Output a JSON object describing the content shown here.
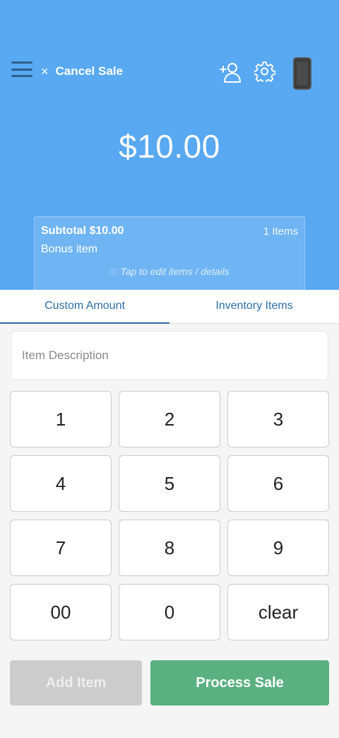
{
  "colors": {
    "header": "#58a8f2",
    "accent": "#2f6fa6",
    "process": "#5bb082",
    "disabled": "#cccccc"
  },
  "header": {
    "cancel_label": "Cancel Sale",
    "close_glyph": "×",
    "icons": [
      "menu-icon",
      "add-customer-icon",
      "gear-icon",
      "card-reader-device-icon"
    ],
    "amount": "$10.00"
  },
  "summary": {
    "subtotal": "Subtotal $10.00",
    "count": "1 Items",
    "item": "Bonus item",
    "info_glyph": "ⓘ",
    "hint": "Tap to edit items / details"
  },
  "tabs": [
    {
      "label": "Custom Amount",
      "active": true
    },
    {
      "label": "Inventory Items",
      "active": false
    }
  ],
  "description": {
    "placeholder": "Item Description",
    "value": ""
  },
  "keypad": [
    "1",
    "2",
    "3",
    "4",
    "5",
    "6",
    "7",
    "8",
    "9",
    "00",
    "0",
    "clear"
  ],
  "actions": {
    "add_item": {
      "label": "Add Item",
      "enabled": false
    },
    "process_sale": {
      "label": "Process Sale",
      "enabled": true
    }
  }
}
